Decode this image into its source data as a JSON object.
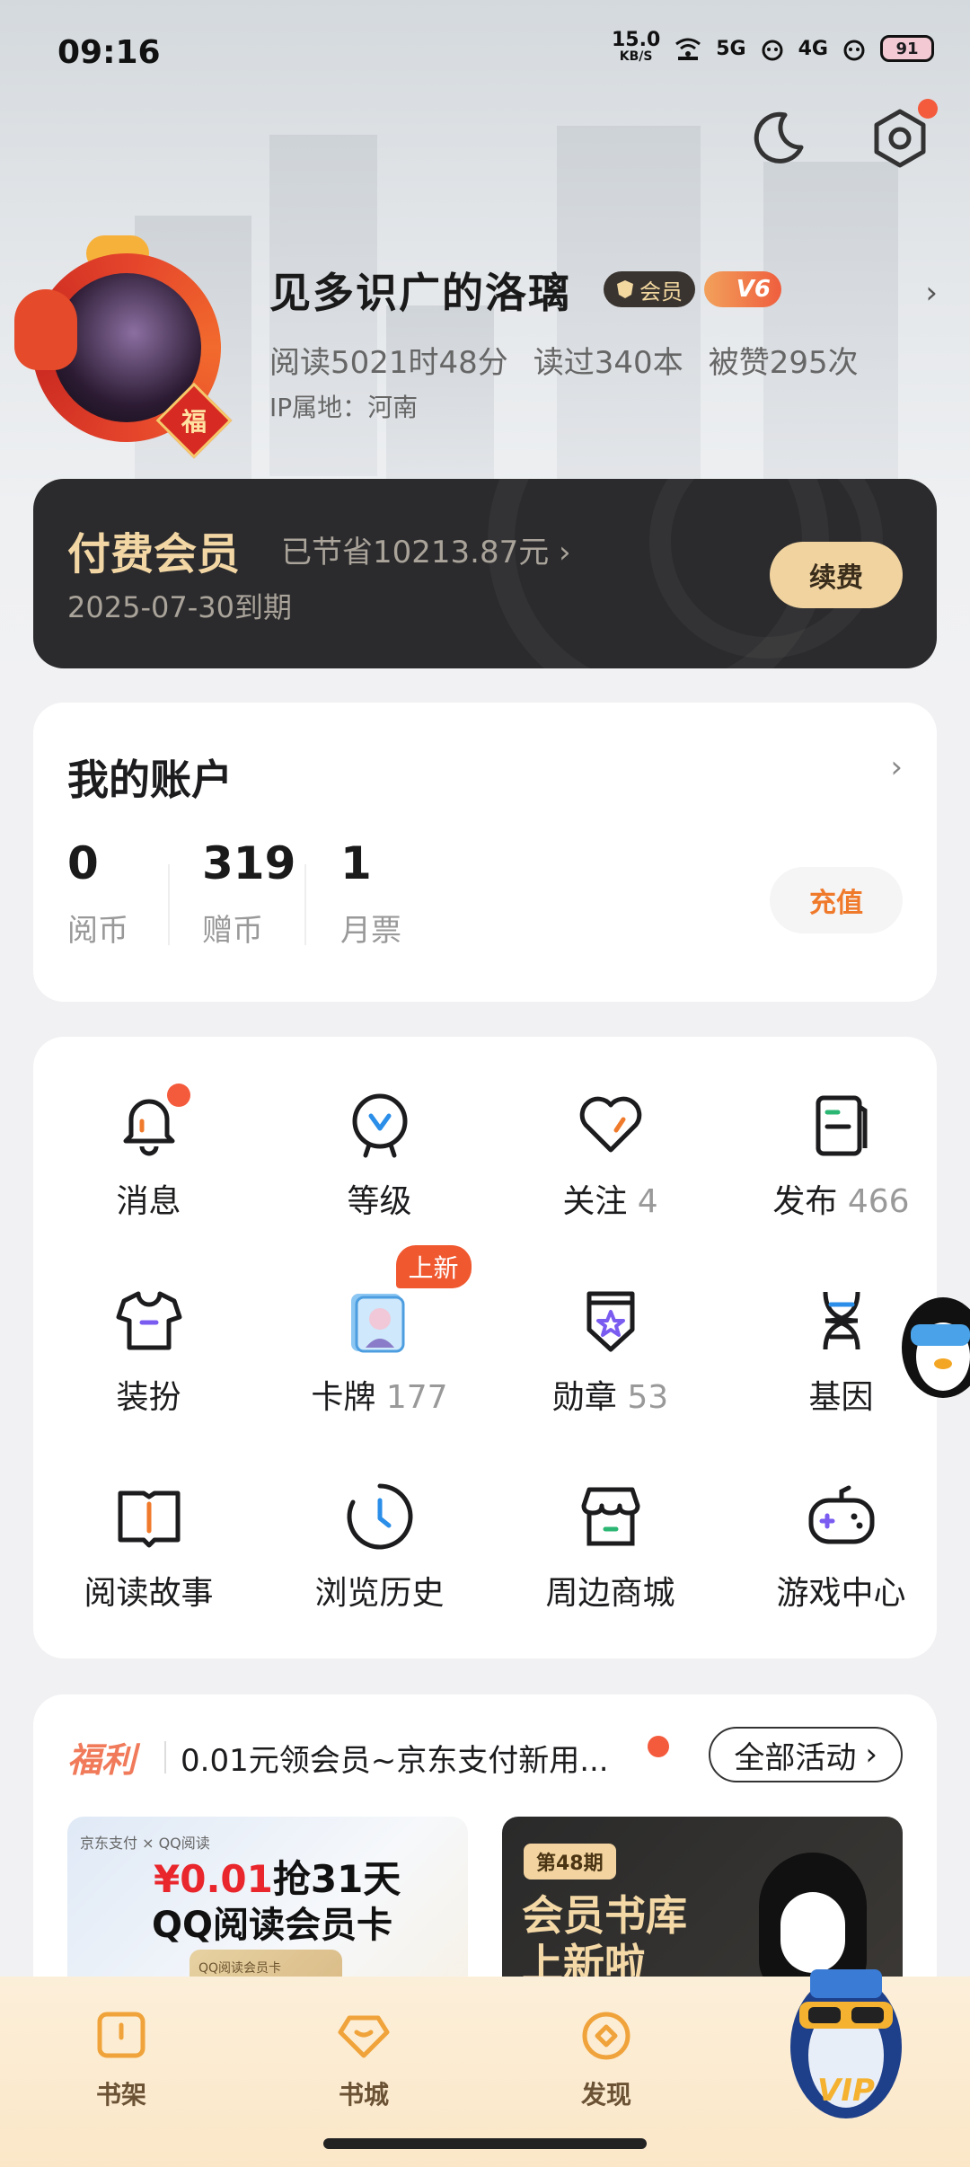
{
  "status_bar": {
    "time": "09:16",
    "net_speed": "15.0",
    "net_unit": "KB/S",
    "sig1": "5G",
    "sig2": "4G",
    "battery": "91"
  },
  "profile": {
    "name": "见多识广的洛璃",
    "vip_badge": "会员",
    "level_badge": "V6",
    "read_time": "阅读5021时48分",
    "books_read": "读过340本",
    "likes": "被赞295次",
    "ip": "IP属地：河南",
    "avatar_badge": "福"
  },
  "member_card": {
    "title": "付费会员",
    "saved": "已节省10213.87元 ›",
    "expiry": "2025-07-30到期",
    "renew_label": "续费"
  },
  "account": {
    "title": "我的账户",
    "items": [
      {
        "value": "0",
        "label": "阅币"
      },
      {
        "value": "319",
        "label": "赠币"
      },
      {
        "value": "1",
        "label": "月票"
      }
    ],
    "recharge_label": "充值"
  },
  "grid": {
    "items": [
      {
        "label": "消息",
        "count": ""
      },
      {
        "label": "等级",
        "count": ""
      },
      {
        "label": "关注",
        "count": "4"
      },
      {
        "label": "发布",
        "count": "466"
      },
      {
        "label": "装扮",
        "count": ""
      },
      {
        "label": "卡牌",
        "count": "177"
      },
      {
        "label": "勋章",
        "count": "53"
      },
      {
        "label": "基因",
        "count": ""
      },
      {
        "label": "阅读故事",
        "count": ""
      },
      {
        "label": "浏览历史",
        "count": ""
      },
      {
        "label": "周边商城",
        "count": ""
      },
      {
        "label": "游戏中心",
        "count": ""
      }
    ],
    "new_badge": "上新"
  },
  "welfare": {
    "title": "福利",
    "text": "0.01元领会员~京东支付新用...",
    "all_label": "全部活动",
    "banner1": {
      "brand": "京东支付 × QQ阅读",
      "price": "¥0.01",
      "line1_rest": "抢31天",
      "line2": "QQ阅读会员卡",
      "card_text": "QQ阅读会员卡"
    },
    "banner2": {
      "tag": "第48期",
      "line1": "会员书库",
      "line2": "上新啦"
    }
  },
  "bottom_nav": {
    "items": [
      {
        "label": "书架"
      },
      {
        "label": "书城"
      },
      {
        "label": "发现"
      }
    ],
    "mascot_text": "VIP"
  },
  "colors": {
    "accent_orange": "#f07a2b",
    "gold": "#f2d6a4",
    "dark_card": "#2b2b2d",
    "red_dot": "#f45a3c"
  }
}
